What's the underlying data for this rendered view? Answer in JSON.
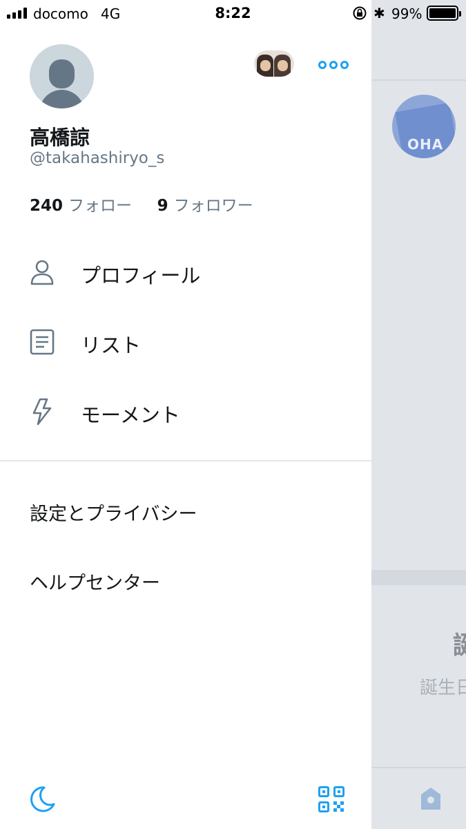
{
  "status_bar": {
    "carrier": "docomo",
    "network": "4G",
    "time": "8:22",
    "battery": "99%",
    "battery_level": 0.99
  },
  "drawer": {
    "profile": {
      "name": "高橋諒",
      "handle": "@takahashiryo_s",
      "following_count": "240",
      "following_label": "フォロー",
      "followers_count": "9",
      "followers_label": "フォロワー"
    },
    "menu": [
      {
        "label": "プロフィール",
        "icon": "person-icon"
      },
      {
        "label": "リスト",
        "icon": "list-icon"
      },
      {
        "label": "モーメント",
        "icon": "lightning-icon"
      }
    ],
    "secondary": [
      {
        "label": "設定とプライバシー"
      },
      {
        "label": "ヘルプセンター"
      }
    ],
    "footer": {
      "left_icon": "moon-icon",
      "right_icon": "qr-code-icon"
    }
  },
  "background": {
    "title_partial": "誕",
    "subtitle_partial": "誕生日"
  },
  "colors": {
    "accent": "#1da1f2",
    "text_primary": "#14171a",
    "text_secondary": "#657786",
    "overlay_gray": "#e1e5ea"
  }
}
